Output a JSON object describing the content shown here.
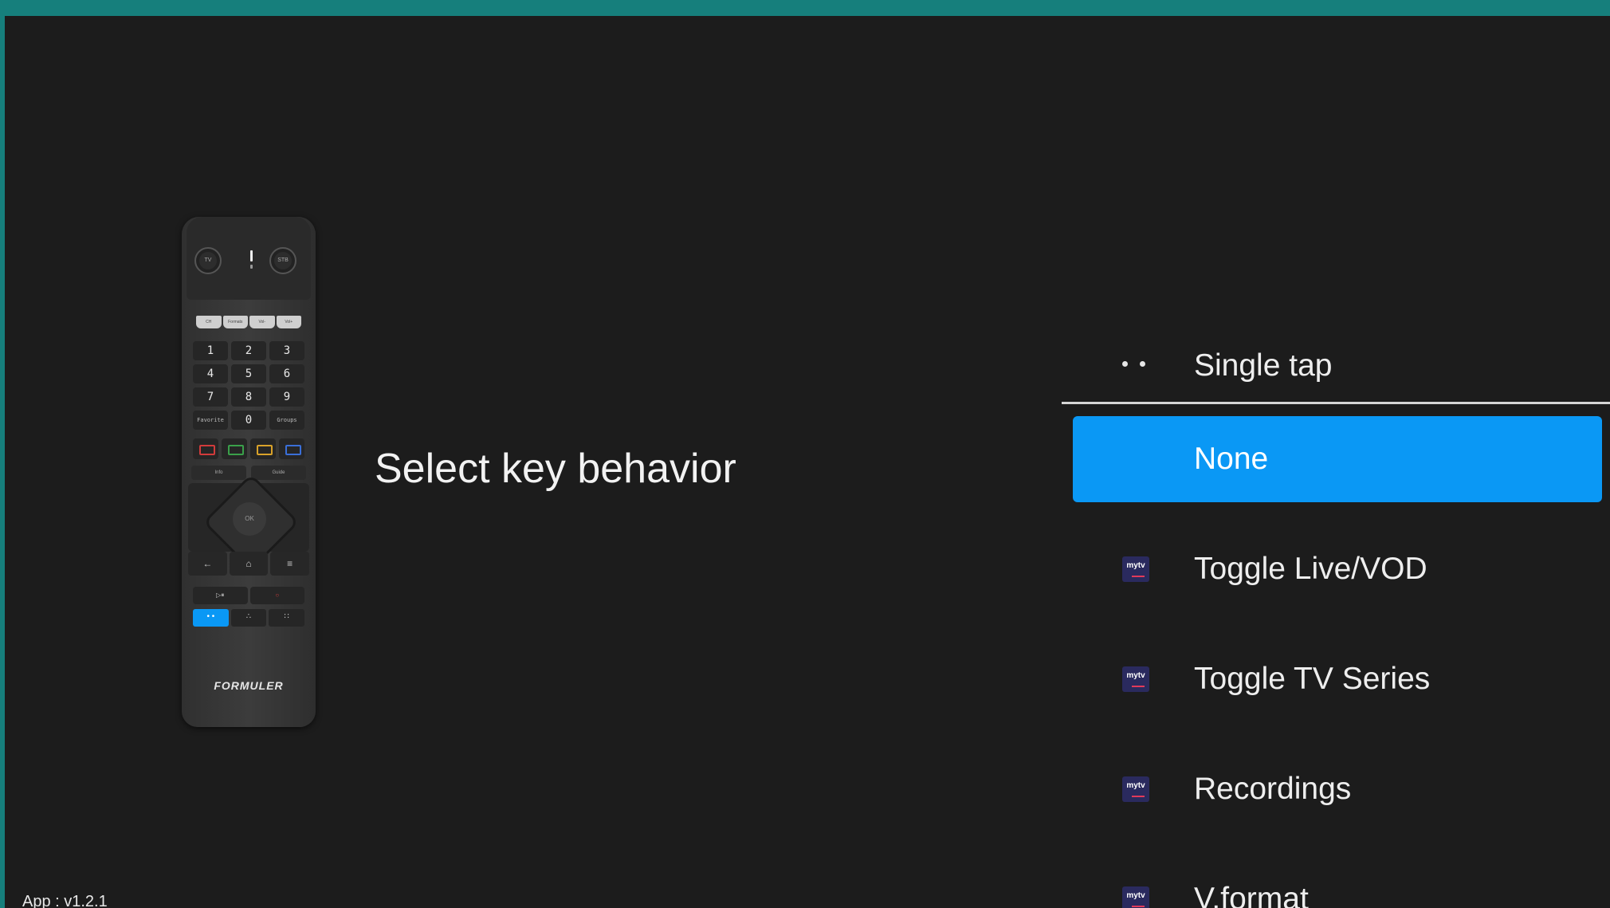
{
  "screen": {
    "title": "Select key behavior",
    "version": "App : v1.2.1"
  },
  "remote": {
    "brand": "FORMULER",
    "top_buttons": [
      "TV",
      "STB"
    ],
    "fn_keys": [
      "CH",
      "Formats",
      "Vol-",
      "Vol+"
    ],
    "numpad": [
      "1",
      "2",
      "3",
      "4",
      "5",
      "6",
      "7",
      "8",
      "9",
      "Favorite",
      "0",
      "Groups"
    ],
    "color_keys": [
      "#d23b3b",
      "#3aa04a",
      "#d9a22a",
      "#3a6fd8"
    ],
    "nav_labels": [
      "Info",
      "Guide"
    ],
    "ok": "OK",
    "bottom_row": [
      "←",
      "⌂",
      "≡"
    ],
    "media_row": [
      "▷⏸",
      "○"
    ],
    "shortcut_row": [
      "• •",
      "∴",
      "∷"
    ]
  },
  "menu": {
    "header": "Single tap",
    "selected": "None",
    "items": [
      {
        "label": "Toggle Live/VOD",
        "icon": "mytv-icon"
      },
      {
        "label": "Toggle TV Series",
        "icon": "mytv-icon"
      },
      {
        "label": "Recordings",
        "icon": "mytv-icon"
      },
      {
        "label": "V.format",
        "icon": "mytv-icon"
      }
    ],
    "icon_text": "mytv"
  },
  "colors": {
    "accent": "#0a98f5",
    "background": "#1c1c1c",
    "frame": "#167f7c"
  }
}
